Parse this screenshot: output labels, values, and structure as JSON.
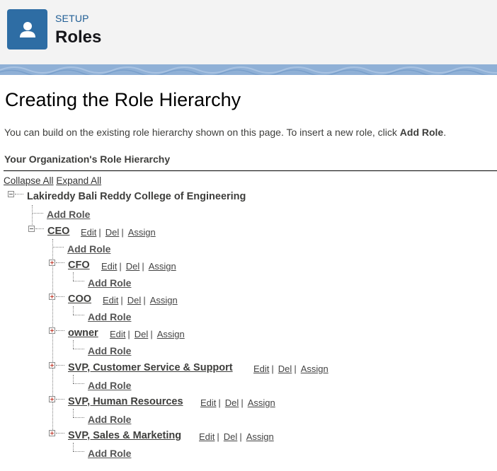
{
  "header": {
    "eyebrow": "SETUP",
    "title": "Roles",
    "icon": "user-icon",
    "icon_color": "#2e6da4"
  },
  "page": {
    "heading": "Creating the Role Hierarchy",
    "intro_text": "You can build on the existing role hierarchy shown on this page. To insert a new role, click ",
    "intro_bold": "Add Role",
    "intro_end": ".",
    "section_title": "Your Organization's Role Hierarchy"
  },
  "controls": {
    "collapse_all": "Collapse All",
    "expand_all": "Expand All"
  },
  "tree": {
    "root": {
      "name": "Lakireddy Bali Reddy College of Engineering",
      "add_role": "Add Role"
    },
    "ceo": {
      "name": "CEO",
      "add_role": "Add Role",
      "edit": "Edit",
      "del": "Del",
      "assign": "Assign",
      "sep": "|"
    },
    "children": [
      {
        "name": "CFO",
        "add_role": "Add Role",
        "edit": "Edit",
        "del": "Del",
        "assign": "Assign",
        "sep": "|"
      },
      {
        "name": "COO",
        "add_role": "Add Role",
        "edit": "Edit",
        "del": "Del",
        "assign": "Assign",
        "sep": "|"
      },
      {
        "name": "owner",
        "add_role": "Add Role",
        "edit": "Edit",
        "del": "Del",
        "assign": "Assign",
        "sep": "|"
      },
      {
        "name": "SVP, Customer Service & Support",
        "add_role": "Add Role",
        "edit": "Edit",
        "del": "Del",
        "assign": "Assign",
        "sep": "|"
      },
      {
        "name": "SVP, Human Resources",
        "add_role": "Add Role",
        "edit": "Edit",
        "del": "Del",
        "assign": "Assign",
        "sep": "|"
      },
      {
        "name": "SVP, Sales & Marketing",
        "add_role": "Add Role",
        "edit": "Edit",
        "del": "Del",
        "assign": "Assign",
        "sep": "|"
      }
    ]
  }
}
